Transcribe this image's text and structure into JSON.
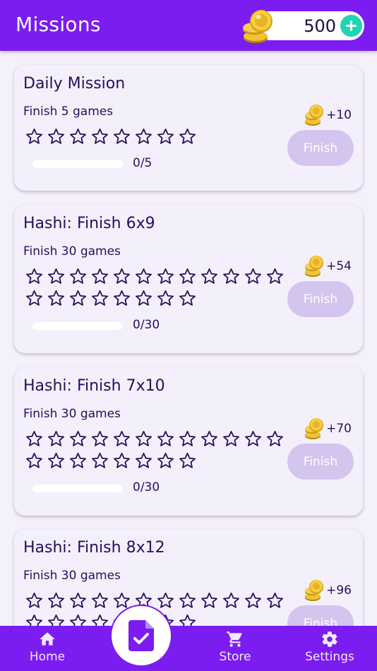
{
  "header": {
    "title": "Missions",
    "coins": "500",
    "coin_icon": "coin-stack-icon",
    "add_icon": "plus-icon"
  },
  "missions": [
    {
      "title": "Daily Mission",
      "subtitle": "Finish 5 games",
      "stars_total": 8,
      "stars_filled": 0,
      "progress_text": "0/5",
      "progress": 0,
      "reward": "+10",
      "button": "Finish"
    },
    {
      "title": "Hashi: Finish 6x9",
      "subtitle": "Finish 30 games",
      "stars_total": 20,
      "stars_filled": 0,
      "progress_text": "0/30",
      "progress": 0,
      "reward": "+54",
      "button": "Finish"
    },
    {
      "title": "Hashi: Finish 7x10",
      "subtitle": "Finish 30 games",
      "stars_total": 20,
      "stars_filled": 0,
      "progress_text": "0/30",
      "progress": 0,
      "reward": "+70",
      "button": "Finish"
    },
    {
      "title": "Hashi: Finish 8x12",
      "subtitle": "Finish 30 games",
      "stars_total": 20,
      "stars_filled": 0,
      "progress_text": "0/30",
      "progress": 0,
      "reward": "+96",
      "button": "Finish"
    }
  ],
  "nav": {
    "home": "Home",
    "store": "Store",
    "settings": "Settings",
    "active_icon": "task-document-icon"
  },
  "colors": {
    "primary": "#7b1cf0",
    "accent": "#1ed5b4",
    "button_disabled": "#d3c5ee",
    "card": "#f3f0fb"
  }
}
